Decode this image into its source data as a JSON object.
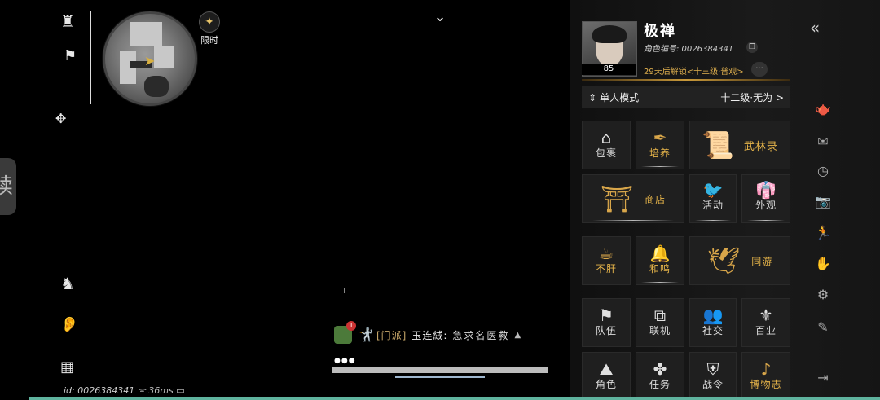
{
  "hud": {
    "limited_label": "限时",
    "side_tab_char": "续",
    "id_text": "id: 0026384341",
    "ping_text": "36ms"
  },
  "chat": {
    "badge": "1",
    "channel": "[门派]",
    "sender": "玉连絨:",
    "message": "急求名医救",
    "dots": "●●●"
  },
  "profile": {
    "name": "极禅",
    "level": "85",
    "role_id": "角色编号: 0026384341",
    "unlock": "29天后解锁<十三级·普观>",
    "more": "···"
  },
  "mode": {
    "label": "单人模式",
    "rank": "十二级·无为",
    "arrow": ">"
  },
  "tiles": [
    {
      "key": "bag",
      "label": "包裹",
      "icon": "bag-icon"
    },
    {
      "key": "cultivate",
      "label": "培养",
      "icon": "brush-icon"
    },
    {
      "key": "wulin",
      "label": "武林录",
      "icon": "scroll-icon"
    },
    {
      "key": "shop",
      "label": "商店",
      "icon": "shop-icon"
    },
    {
      "key": "event",
      "label": "活动",
      "icon": "bird-icon"
    },
    {
      "key": "appearance",
      "label": "外观",
      "icon": "robe-icon"
    },
    {
      "key": "buyu",
      "label": "不肝",
      "icon": "teacup-icon"
    },
    {
      "key": "heming",
      "label": "和鸣",
      "icon": "bell-icon"
    },
    {
      "key": "tongyou",
      "label": "同游",
      "icon": "cranes-icon"
    },
    {
      "key": "team",
      "label": "队伍",
      "icon": "flag-icon"
    },
    {
      "key": "online",
      "label": "联机",
      "icon": "link-icon"
    },
    {
      "key": "social",
      "label": "社交",
      "icon": "people-icon"
    },
    {
      "key": "career",
      "label": "百业",
      "icon": "banner-icon"
    },
    {
      "key": "role",
      "label": "角色",
      "icon": "hat-icon"
    },
    {
      "key": "task",
      "label": "任务",
      "icon": "flower-icon"
    },
    {
      "key": "guild",
      "label": "战令",
      "icon": "shield-icon"
    },
    {
      "key": "museum",
      "label": "博物志",
      "icon": "pipa-icon"
    }
  ]
}
